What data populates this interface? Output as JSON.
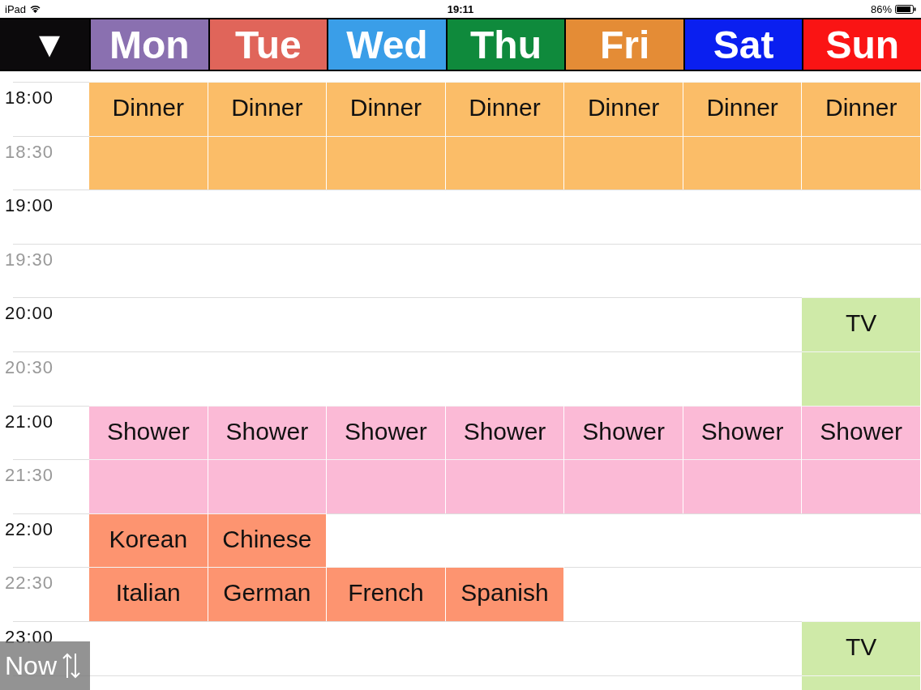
{
  "status_bar": {
    "device": "iPad",
    "time": "19:11",
    "battery": "86%"
  },
  "header": {
    "menu": "▼",
    "days": [
      {
        "label": "Mon",
        "color": "#8a70b0"
      },
      {
        "label": "Tue",
        "color": "#e0655a"
      },
      {
        "label": "Wed",
        "color": "#3a9ee8"
      },
      {
        "label": "Thu",
        "color": "#0f8a3c"
      },
      {
        "label": "Fri",
        "color": "#e48c36"
      },
      {
        "label": "Sat",
        "color": "#0a1ff0"
      },
      {
        "label": "Sun",
        "color": "#fa1414"
      }
    ]
  },
  "rows": [
    {
      "time": "18:00",
      "kind": "hour",
      "cells": [
        {
          "kind": "event",
          "label": "Dinner",
          "color": "#fbbd68"
        },
        {
          "kind": "event",
          "label": "Dinner",
          "color": "#fbbd68"
        },
        {
          "kind": "event",
          "label": "Dinner",
          "color": "#fbbd68"
        },
        {
          "kind": "event",
          "label": "Dinner",
          "color": "#fbbd68"
        },
        {
          "kind": "event",
          "label": "Dinner",
          "color": "#fbbd68"
        },
        {
          "kind": "event",
          "label": "Dinner",
          "color": "#fbbd68"
        },
        {
          "kind": "event",
          "label": "Dinner",
          "color": "#fbbd68"
        }
      ]
    },
    {
      "time": "18:30",
      "kind": "half",
      "cells": [
        {
          "kind": "continuation",
          "color": "#fbbd68"
        },
        {
          "kind": "continuation",
          "color": "#fbbd68"
        },
        {
          "kind": "continuation",
          "color": "#fbbd68"
        },
        {
          "kind": "continuation",
          "color": "#fbbd68"
        },
        {
          "kind": "continuation",
          "color": "#fbbd68"
        },
        {
          "kind": "continuation",
          "color": "#fbbd68"
        },
        {
          "kind": "continuation",
          "color": "#fbbd68"
        }
      ]
    },
    {
      "time": "19:00",
      "kind": "hour",
      "cells": [
        {
          "kind": "empty"
        },
        {
          "kind": "empty"
        },
        {
          "kind": "empty"
        },
        {
          "kind": "empty"
        },
        {
          "kind": "empty"
        },
        {
          "kind": "empty"
        },
        {
          "kind": "empty"
        }
      ]
    },
    {
      "time": "19:30",
      "kind": "half",
      "cells": [
        {
          "kind": "empty"
        },
        {
          "kind": "empty"
        },
        {
          "kind": "empty"
        },
        {
          "kind": "empty"
        },
        {
          "kind": "empty"
        },
        {
          "kind": "empty"
        },
        {
          "kind": "empty"
        }
      ]
    },
    {
      "time": "20:00",
      "kind": "hour",
      "cells": [
        {
          "kind": "empty"
        },
        {
          "kind": "empty"
        },
        {
          "kind": "empty"
        },
        {
          "kind": "empty"
        },
        {
          "kind": "empty"
        },
        {
          "kind": "empty"
        },
        {
          "kind": "event",
          "label": "TV",
          "color": "#cfeaa8"
        }
      ]
    },
    {
      "time": "20:30",
      "kind": "half",
      "cells": [
        {
          "kind": "empty"
        },
        {
          "kind": "empty"
        },
        {
          "kind": "empty"
        },
        {
          "kind": "empty"
        },
        {
          "kind": "empty"
        },
        {
          "kind": "empty"
        },
        {
          "kind": "continuation",
          "color": "#cfeaa8"
        }
      ]
    },
    {
      "time": "21:00",
      "kind": "hour",
      "cells": [
        {
          "kind": "event",
          "label": "Shower",
          "color": "#fbbad6"
        },
        {
          "kind": "event",
          "label": "Shower",
          "color": "#fbbad6"
        },
        {
          "kind": "event",
          "label": "Shower",
          "color": "#fbbad6"
        },
        {
          "kind": "event",
          "label": "Shower",
          "color": "#fbbad6"
        },
        {
          "kind": "event",
          "label": "Shower",
          "color": "#fbbad6"
        },
        {
          "kind": "event",
          "label": "Shower",
          "color": "#fbbad6"
        },
        {
          "kind": "event",
          "label": "Shower",
          "color": "#fbbad6"
        }
      ]
    },
    {
      "time": "21:30",
      "kind": "half",
      "cells": [
        {
          "kind": "continuation",
          "color": "#fbbad6"
        },
        {
          "kind": "continuation",
          "color": "#fbbad6"
        },
        {
          "kind": "continuation",
          "color": "#fbbad6"
        },
        {
          "kind": "continuation",
          "color": "#fbbad6"
        },
        {
          "kind": "continuation",
          "color": "#fbbad6"
        },
        {
          "kind": "continuation",
          "color": "#fbbad6"
        },
        {
          "kind": "continuation",
          "color": "#fbbad6"
        }
      ]
    },
    {
      "time": "22:00",
      "kind": "hour",
      "cells": [
        {
          "kind": "event",
          "label": "Korean",
          "color": "#fd9470"
        },
        {
          "kind": "event",
          "label": "Chinese",
          "color": "#fd9470"
        },
        {
          "kind": "empty"
        },
        {
          "kind": "empty"
        },
        {
          "kind": "empty"
        },
        {
          "kind": "empty"
        },
        {
          "kind": "empty"
        }
      ]
    },
    {
      "time": "22:30",
      "kind": "half",
      "cells": [
        {
          "kind": "event",
          "label": "Italian",
          "color": "#fd9470"
        },
        {
          "kind": "event",
          "label": "German",
          "color": "#fd9470"
        },
        {
          "kind": "event",
          "label": "French",
          "color": "#fd9470"
        },
        {
          "kind": "event",
          "label": "Spanish",
          "color": "#fd9470"
        },
        {
          "kind": "empty"
        },
        {
          "kind": "empty"
        },
        {
          "kind": "empty"
        }
      ]
    },
    {
      "time": "23:00",
      "kind": "hour",
      "cells": [
        {
          "kind": "empty"
        },
        {
          "kind": "empty"
        },
        {
          "kind": "empty"
        },
        {
          "kind": "empty"
        },
        {
          "kind": "empty"
        },
        {
          "kind": "empty"
        },
        {
          "kind": "event",
          "label": "TV",
          "color": "#cfeaa8"
        }
      ]
    }
  ],
  "now_button": {
    "label": "Now"
  }
}
